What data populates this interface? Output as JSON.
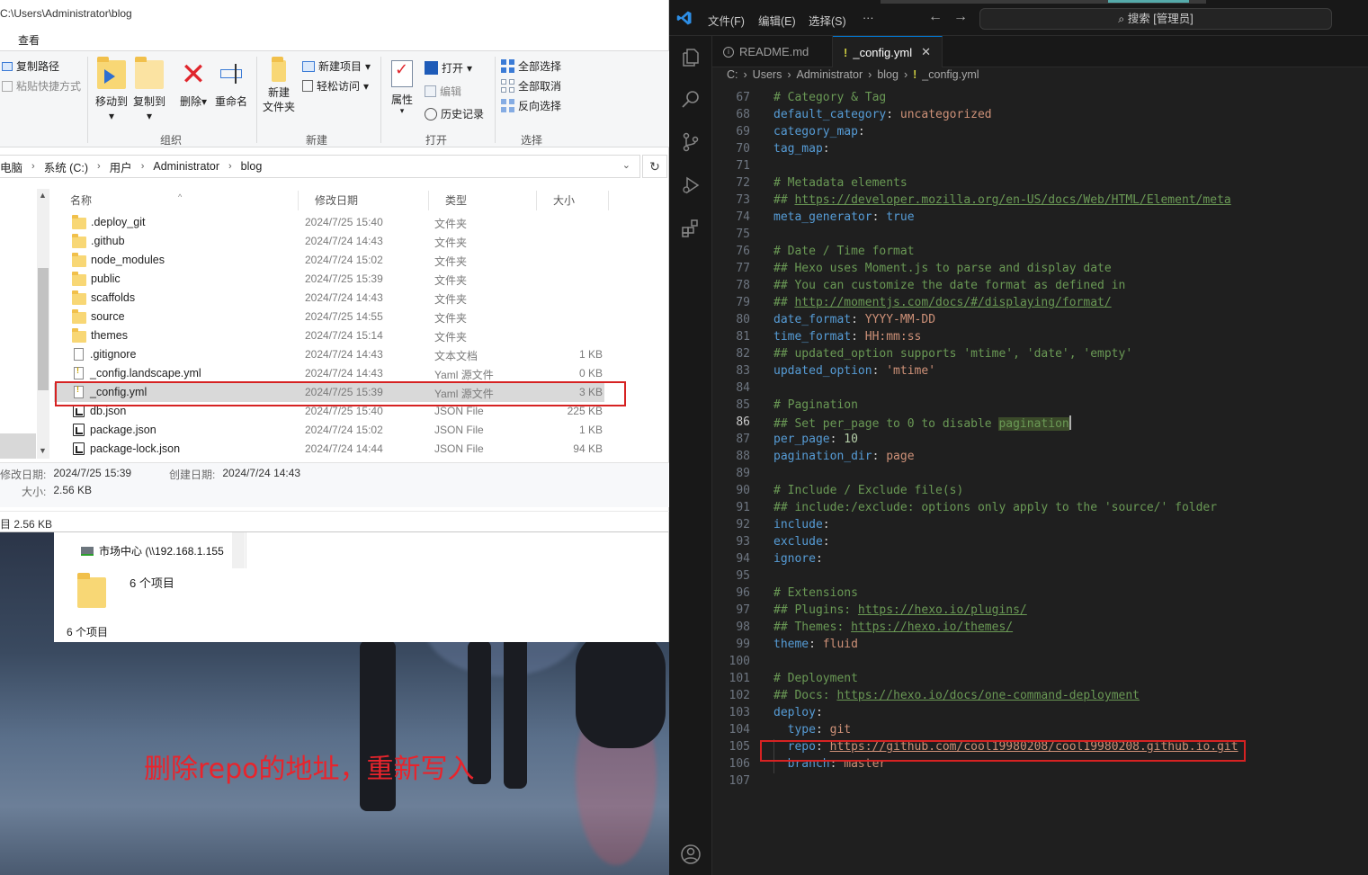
{
  "explorer": {
    "title_path": "C:\\Users\\Administrator\\blog",
    "menu_view": "查看",
    "ribbon": {
      "copy_path": "复制路径",
      "paste_shortcut": "粘贴快捷方式",
      "move_to": "移动到",
      "copy_to": "复制到",
      "delete": "删除",
      "rename": "重命名",
      "new_folder_line1": "新建",
      "new_folder_line2": "文件夹",
      "new_item": "新建项目",
      "easy_access": "轻松访问",
      "properties": "属性",
      "open": "打开",
      "edit": "编辑",
      "history": "历史记录",
      "select_all": "全部选择",
      "select_none": "全部取消",
      "invert_selection": "反向选择",
      "group_organize": "组织",
      "group_new": "新建",
      "group_open": "打开",
      "group_select": "选择"
    },
    "address": [
      "电脑",
      "系统 (C:)",
      "用户",
      "Administrator",
      "blog"
    ],
    "columns": {
      "name": "名称",
      "date": "修改日期",
      "type": "类型",
      "size": "大小"
    },
    "files": [
      {
        "name": ".deploy_git",
        "date": "2024/7/25 15:40",
        "type": "文件夹",
        "size": "",
        "icon": "folder-icon"
      },
      {
        "name": ".github",
        "date": "2024/7/24 14:43",
        "type": "文件夹",
        "size": "",
        "icon": "folder-icon"
      },
      {
        "name": "node_modules",
        "date": "2024/7/24 15:02",
        "type": "文件夹",
        "size": "",
        "icon": "folder-icon"
      },
      {
        "name": "public",
        "date": "2024/7/25 15:39",
        "type": "文件夹",
        "size": "",
        "icon": "folder-icon"
      },
      {
        "name": "scaffolds",
        "date": "2024/7/24 14:43",
        "type": "文件夹",
        "size": "",
        "icon": "folder-icon"
      },
      {
        "name": "source",
        "date": "2024/7/25 14:55",
        "type": "文件夹",
        "size": "",
        "icon": "folder-icon"
      },
      {
        "name": "themes",
        "date": "2024/7/24 15:14",
        "type": "文件夹",
        "size": "",
        "icon": "folder-icon"
      },
      {
        "name": ".gitignore",
        "date": "2024/7/24 14:43",
        "type": "文本文档",
        "size": "1 KB",
        "icon": "text-file-icon"
      },
      {
        "name": "_config.landscape.yml",
        "date": "2024/7/24 14:43",
        "type": "Yaml 源文件",
        "size": "0 KB",
        "icon": "yaml-file-icon"
      },
      {
        "name": "_config.yml",
        "date": "2024/7/25 15:39",
        "type": "Yaml 源文件",
        "size": "3 KB",
        "icon": "yaml-file-icon",
        "selected": true
      },
      {
        "name": "db.json",
        "date": "2024/7/25 15:40",
        "type": "JSON File",
        "size": "225 KB",
        "icon": "json-file-icon"
      },
      {
        "name": "package.json",
        "date": "2024/7/24 15:02",
        "type": "JSON File",
        "size": "1 KB",
        "icon": "json-file-icon"
      },
      {
        "name": "package-lock.json",
        "date": "2024/7/24 14:44",
        "type": "JSON File",
        "size": "94 KB",
        "icon": "json-file-icon"
      }
    ],
    "details": {
      "modified_label": "修改日期:",
      "modified_value": "2024/7/25 15:39",
      "created_label": "创建日期:",
      "created_value": "2024/7/24 14:43",
      "size_label": "大小:",
      "size_value": "2.56 KB"
    },
    "status": "目 2.56 KB"
  },
  "explorer2": {
    "nav_item": "市场中心 (\\\\192.168.1.155",
    "count_large": "6 个项目",
    "count_status": "6 个项目"
  },
  "wallpaper_note": "删除repo的地址，重新写入",
  "vscode": {
    "menu": [
      "文件(F)",
      "编辑(E)",
      "选择(S)",
      "···"
    ],
    "search": "搜索 [管理员]",
    "tabs": [
      {
        "label": "README.md",
        "active": false
      },
      {
        "label": "_config.yml",
        "active": true
      }
    ],
    "breadcrumb": [
      "C:",
      "Users",
      "Administrator",
      "blog",
      "_config.yml"
    ],
    "current_line": 86,
    "lines": [
      {
        "n": 67,
        "t": "# Category & Tag"
      },
      {
        "n": 68,
        "t": "default_category: uncategorized"
      },
      {
        "n": 69,
        "t": "category_map:"
      },
      {
        "n": 70,
        "t": "tag_map:"
      },
      {
        "n": 71,
        "t": ""
      },
      {
        "n": 72,
        "t": "# Metadata elements"
      },
      {
        "n": 73,
        "t": "## https://developer.mozilla.org/en-US/docs/Web/HTML/Element/meta"
      },
      {
        "n": 74,
        "t": "meta_generator: true"
      },
      {
        "n": 75,
        "t": ""
      },
      {
        "n": 76,
        "t": "# Date / Time format"
      },
      {
        "n": 77,
        "t": "## Hexo uses Moment.js to parse and display date"
      },
      {
        "n": 78,
        "t": "## You can customize the date format as defined in"
      },
      {
        "n": 79,
        "t": "## http://momentjs.com/docs/#/displaying/format/"
      },
      {
        "n": 80,
        "t": "date_format: YYYY-MM-DD"
      },
      {
        "n": 81,
        "t": "time_format: HH:mm:ss"
      },
      {
        "n": 82,
        "t": "## updated_option supports 'mtime', 'date', 'empty'"
      },
      {
        "n": 83,
        "t": "updated_option: 'mtime'"
      },
      {
        "n": 84,
        "t": ""
      },
      {
        "n": 85,
        "t": "# Pagination"
      },
      {
        "n": 86,
        "t": "## Set per_page to 0 to disable pagination"
      },
      {
        "n": 87,
        "t": "per_page: 10"
      },
      {
        "n": 88,
        "t": "pagination_dir: page"
      },
      {
        "n": 89,
        "t": ""
      },
      {
        "n": 90,
        "t": "# Include / Exclude file(s)"
      },
      {
        "n": 91,
        "t": "## include:/exclude: options only apply to the 'source/' folder"
      },
      {
        "n": 92,
        "t": "include:"
      },
      {
        "n": 93,
        "t": "exclude:"
      },
      {
        "n": 94,
        "t": "ignore:"
      },
      {
        "n": 95,
        "t": ""
      },
      {
        "n": 96,
        "t": "# Extensions"
      },
      {
        "n": 97,
        "t": "## Plugins: https://hexo.io/plugins/"
      },
      {
        "n": 98,
        "t": "## Themes: https://hexo.io/themes/"
      },
      {
        "n": 99,
        "t": "theme: fluid"
      },
      {
        "n": 100,
        "t": ""
      },
      {
        "n": 101,
        "t": "# Deployment"
      },
      {
        "n": 102,
        "t": "## Docs: https://hexo.io/docs/one-command-deployment"
      },
      {
        "n": 103,
        "t": "deploy:"
      },
      {
        "n": 104,
        "t": "  type: git"
      },
      {
        "n": 105,
        "t": "  repo: https://github.com/cool19980208/cool19980208.github.io.git"
      },
      {
        "n": 106,
        "t": "  branch: master"
      },
      {
        "n": 107,
        "t": ""
      }
    ]
  },
  "colors": {
    "highlight_red": "#d62222",
    "vscode_bg": "#1f1f1f",
    "comment": "#6a9955",
    "key": "#569cd6",
    "string": "#ce9178"
  }
}
